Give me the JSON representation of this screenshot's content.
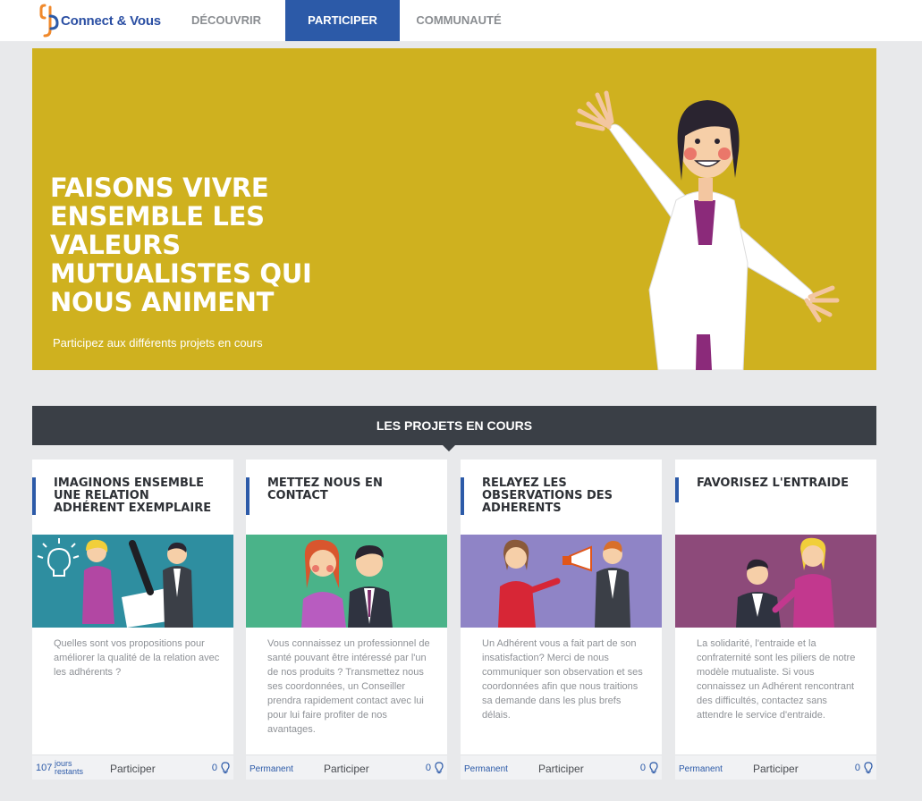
{
  "nav": {
    "logo_text": "Connect & Vous",
    "items": [
      {
        "label": "DÉCOUVRIR",
        "active": false
      },
      {
        "label": "PARTICIPER",
        "active": true
      },
      {
        "label": "COMMUNAUTÉ",
        "active": false
      }
    ]
  },
  "hero": {
    "title": "FAISONS VIVRE ENSEMBLE LES VALEURS MUTUALISTES QUI NOUS ANIMENT",
    "subtitle": "Participez aux différents projets en cours"
  },
  "section": {
    "title": "LES PROJETS EN COURS"
  },
  "cards": [
    {
      "title": "IMAGINONS ENSEMBLE UNE RELATION ADHÉRENT EXEMPLAIRE",
      "description": "Quelles sont vos propositions pour améliorer la qualité de la relation avec les adhérents ?",
      "days": "107",
      "days_label": "jours restants",
      "action": "Participer",
      "count": "0",
      "art_color": "#2e8ea0"
    },
    {
      "title": "METTEZ NOUS EN CONTACT",
      "description": "Vous connaissez un professionnel de santé pouvant être intéressé par l'un de nos produits ? Transmettez nous ses coordonnées, un Conseiller prendra rapidement contact avec lui pour lui faire profiter de nos avantages.",
      "status": "Permanent",
      "action": "Participer",
      "count": "0",
      "art_color": "#4ab389"
    },
    {
      "title": "RELAYEZ LES OBSERVATIONS DES ADHERENTS",
      "description": "Un Adhérent vous a fait part de son insatisfaction? Merci de nous communiquer son observation et ses coordonnées afin que nous traitions sa demande dans les plus brefs délais.",
      "status": "Permanent",
      "action": "Participer",
      "count": "0",
      "art_color": "#8f84c6"
    },
    {
      "title": "FAVORISEZ L'ENTRAIDE",
      "description": "La solidarité, l'entraide et la confraternité sont les piliers de notre modèle mutualiste. Si vous connaissez un Adhérent rencontrant des difficultés, contactez sans attendre le service d'entraide.",
      "status": "Permanent",
      "action": "Participer",
      "count": "0",
      "art_color": "#8d4a7a"
    }
  ],
  "colors": {
    "brand_blue": "#2c5aa8",
    "hero_yellow": "#cfb11f",
    "section_dark": "#3a3f46",
    "logo_orange": "#f0892b"
  }
}
